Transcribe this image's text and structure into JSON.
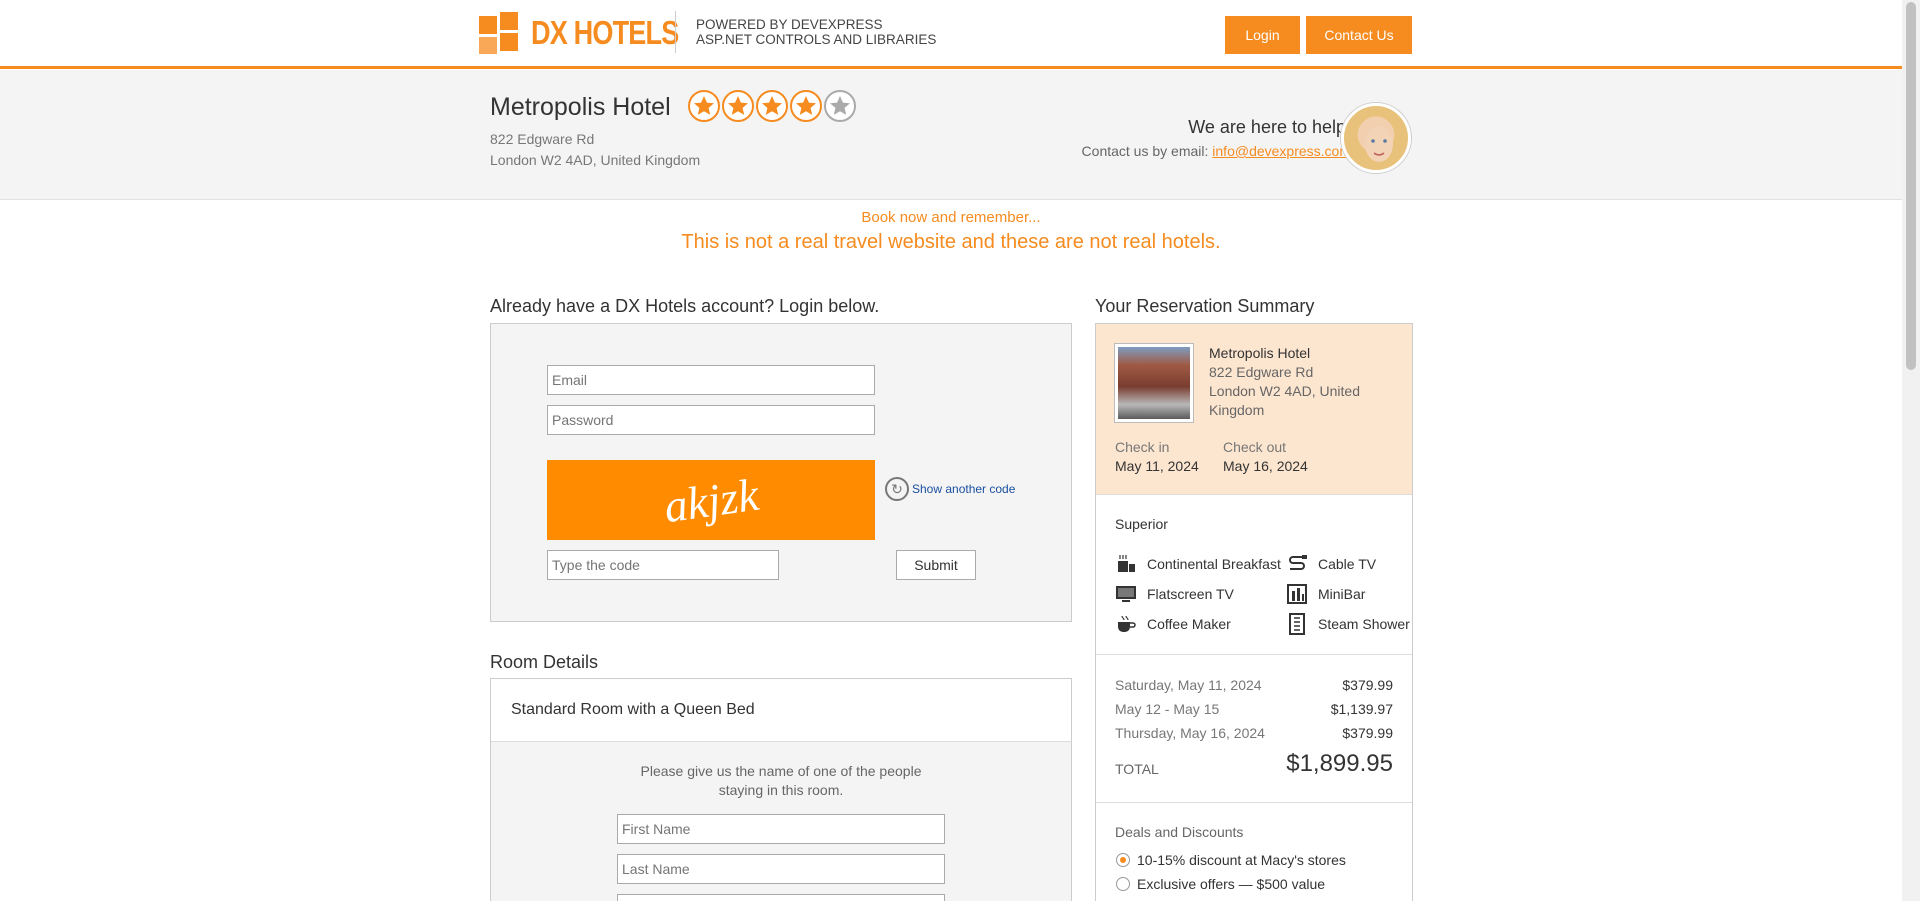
{
  "header": {
    "logo_text": "DX HOTELS",
    "powered_line1": "POWERED BY DEVEXPRESS",
    "powered_line2": "ASP.NET CONTROLS AND LIBRARIES",
    "login_label": "Login",
    "contact_label": "Contact Us",
    "accent_color": "#f68b1f"
  },
  "hotel": {
    "name": "Metropolis Hotel",
    "rating": 4,
    "rating_max": 5,
    "address_line1": "822 Edgware Rd",
    "address_line2": "London W2 4AD, United Kingdom"
  },
  "help": {
    "title": "We are here to help.",
    "email_prefix": "Contact us by email: ",
    "email": "info@devexpress.com"
  },
  "notice": {
    "line1": "Book now and remember...",
    "line2": "This is not a real travel website and these are not real hotels."
  },
  "login": {
    "title": "Already have a DX Hotels account? Login below.",
    "email_placeholder": "Email",
    "password_placeholder": "Password",
    "captcha_text": "akjzk",
    "refresh_label": "Show another code",
    "code_placeholder": "Type the code",
    "submit_label": "Submit"
  },
  "room": {
    "section_title": "Room Details",
    "room_name": "Standard Room with a Queen Bed",
    "instructions": "Please give us the name of one of the people staying in this room.",
    "first_name_placeholder": "First Name",
    "last_name_placeholder": "Last Name"
  },
  "summary": {
    "title": "Your Reservation Summary",
    "hotel_name": "Metropolis Hotel",
    "hotel_address1": "822 Edgware Rd",
    "hotel_address2": "London W2 4AD, United Kingdom",
    "checkin_label": "Check in",
    "checkin_date": "May 11, 2024",
    "checkout_label": "Check out",
    "checkout_date": "May 16, 2024",
    "room_type": "Superior",
    "amenities": [
      {
        "label": "Continental Breakfast",
        "icon": "breakfast-icon"
      },
      {
        "label": "Cable TV",
        "icon": "cable-icon"
      },
      {
        "label": "Flatscreen TV",
        "icon": "tv-icon"
      },
      {
        "label": "MiniBar",
        "icon": "minibar-icon"
      },
      {
        "label": "Coffee Maker",
        "icon": "coffee-icon"
      },
      {
        "label": "Steam Shower",
        "icon": "shower-icon"
      }
    ],
    "prices": [
      {
        "label": "Saturday, May 11, 2024",
        "value": "$379.99"
      },
      {
        "label": "May 12 - May 15",
        "value": "$1,139.97"
      },
      {
        "label": "Thursday, May 16, 2024",
        "value": "$379.99"
      }
    ],
    "total_label": "TOTAL",
    "total_value": "$1,899.95",
    "deals_title": "Deals and Discounts",
    "deals": [
      {
        "label": "10-15% discount at Macy's stores",
        "selected": true
      },
      {
        "label": "Exclusive offers — $500 value",
        "selected": false
      }
    ]
  }
}
